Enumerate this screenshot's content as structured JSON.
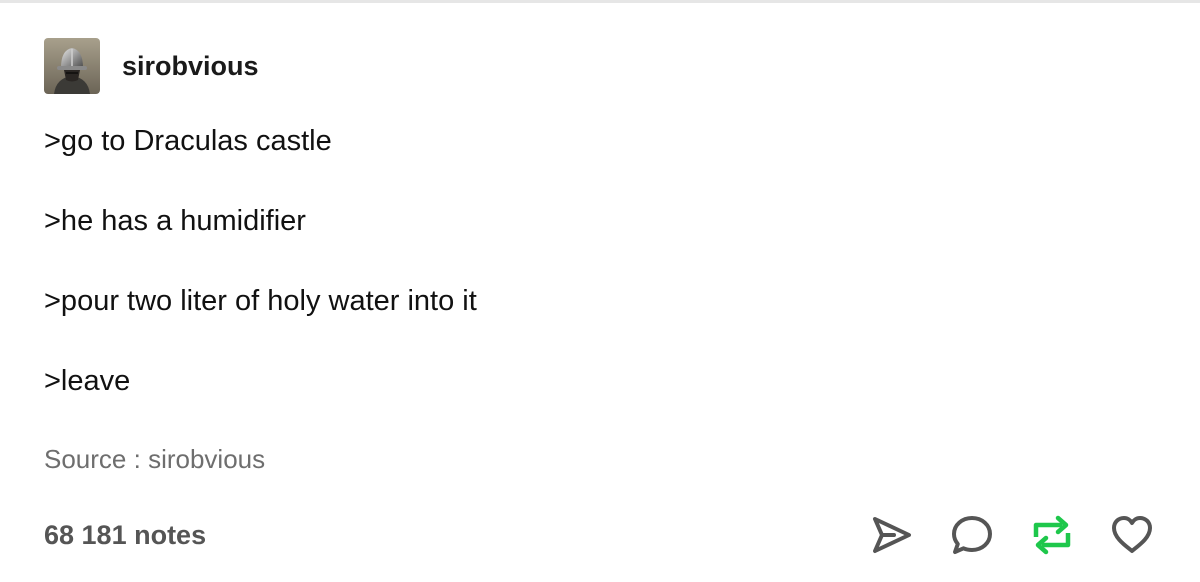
{
  "post": {
    "username": "sirobvious",
    "avatar_icon": "knight-helmet-avatar",
    "lines": [
      ">go to Draculas castle",
      ">he has a humidifier",
      ">pour two liter of holy water into it",
      ">leave"
    ],
    "source_label": "Source : ",
    "source_value": "sirobvious",
    "notes": "68 181 notes"
  },
  "actions": [
    {
      "name": "share-icon",
      "color": "#555555"
    },
    {
      "name": "reply-icon",
      "color": "#555555"
    },
    {
      "name": "reblog-icon",
      "color": "#1ec74b",
      "active": true
    },
    {
      "name": "like-icon",
      "color": "#555555"
    }
  ],
  "colors": {
    "text": "#111111",
    "muted": "#6e6e6e",
    "reblog_active": "#1ec74b"
  }
}
